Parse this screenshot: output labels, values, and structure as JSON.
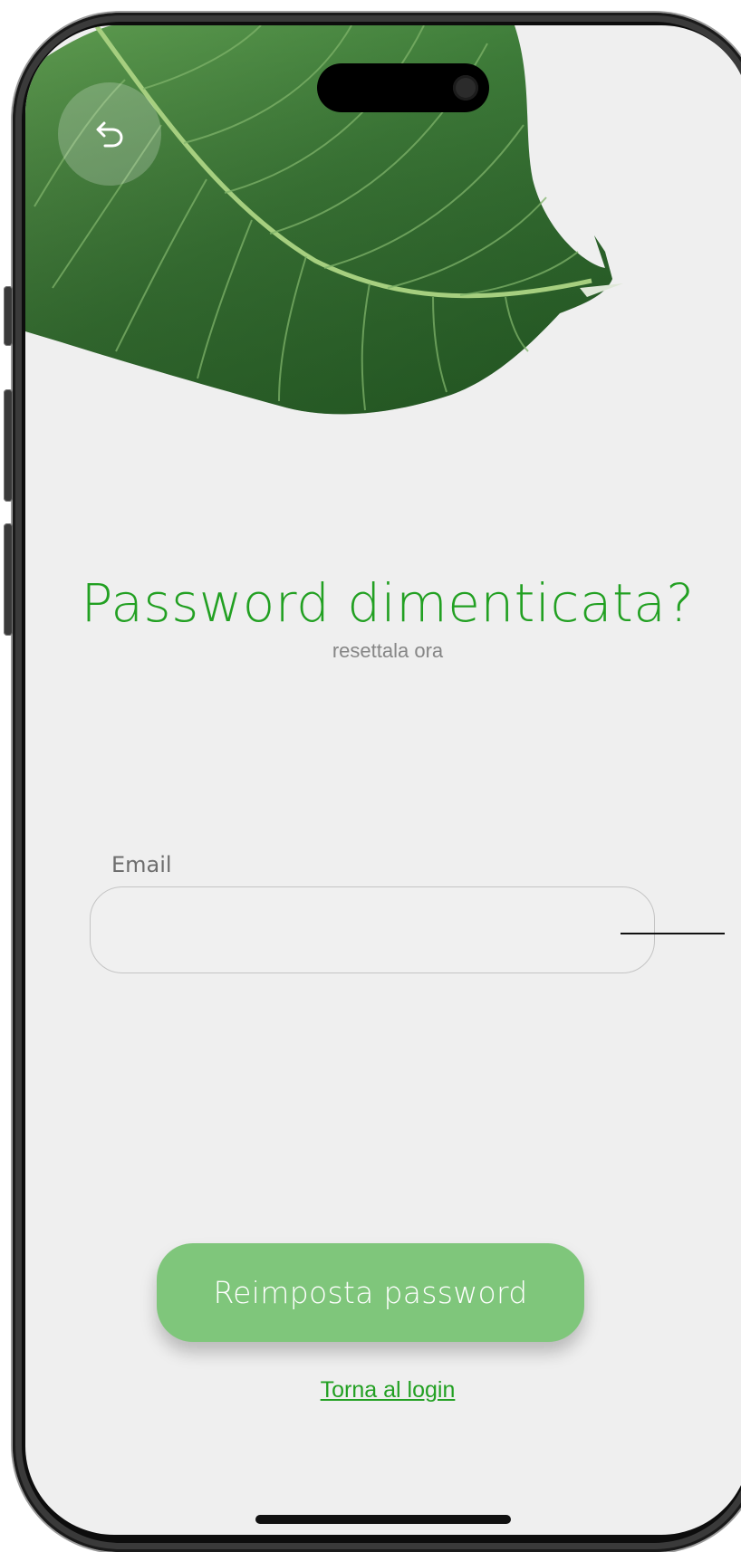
{
  "screen": {
    "title": "Password dimenticata?",
    "subtitle": "resettala ora"
  },
  "email_field": {
    "label": "Email",
    "value": "",
    "placeholder": ""
  },
  "actions": {
    "reset_button_label": "Reimposta password",
    "back_to_login_label": "Torna al login",
    "back_icon": "undo-arrow-icon"
  },
  "colors": {
    "accent_green": "#22a022",
    "button_green": "#7fc67b",
    "background": "#efefef"
  }
}
